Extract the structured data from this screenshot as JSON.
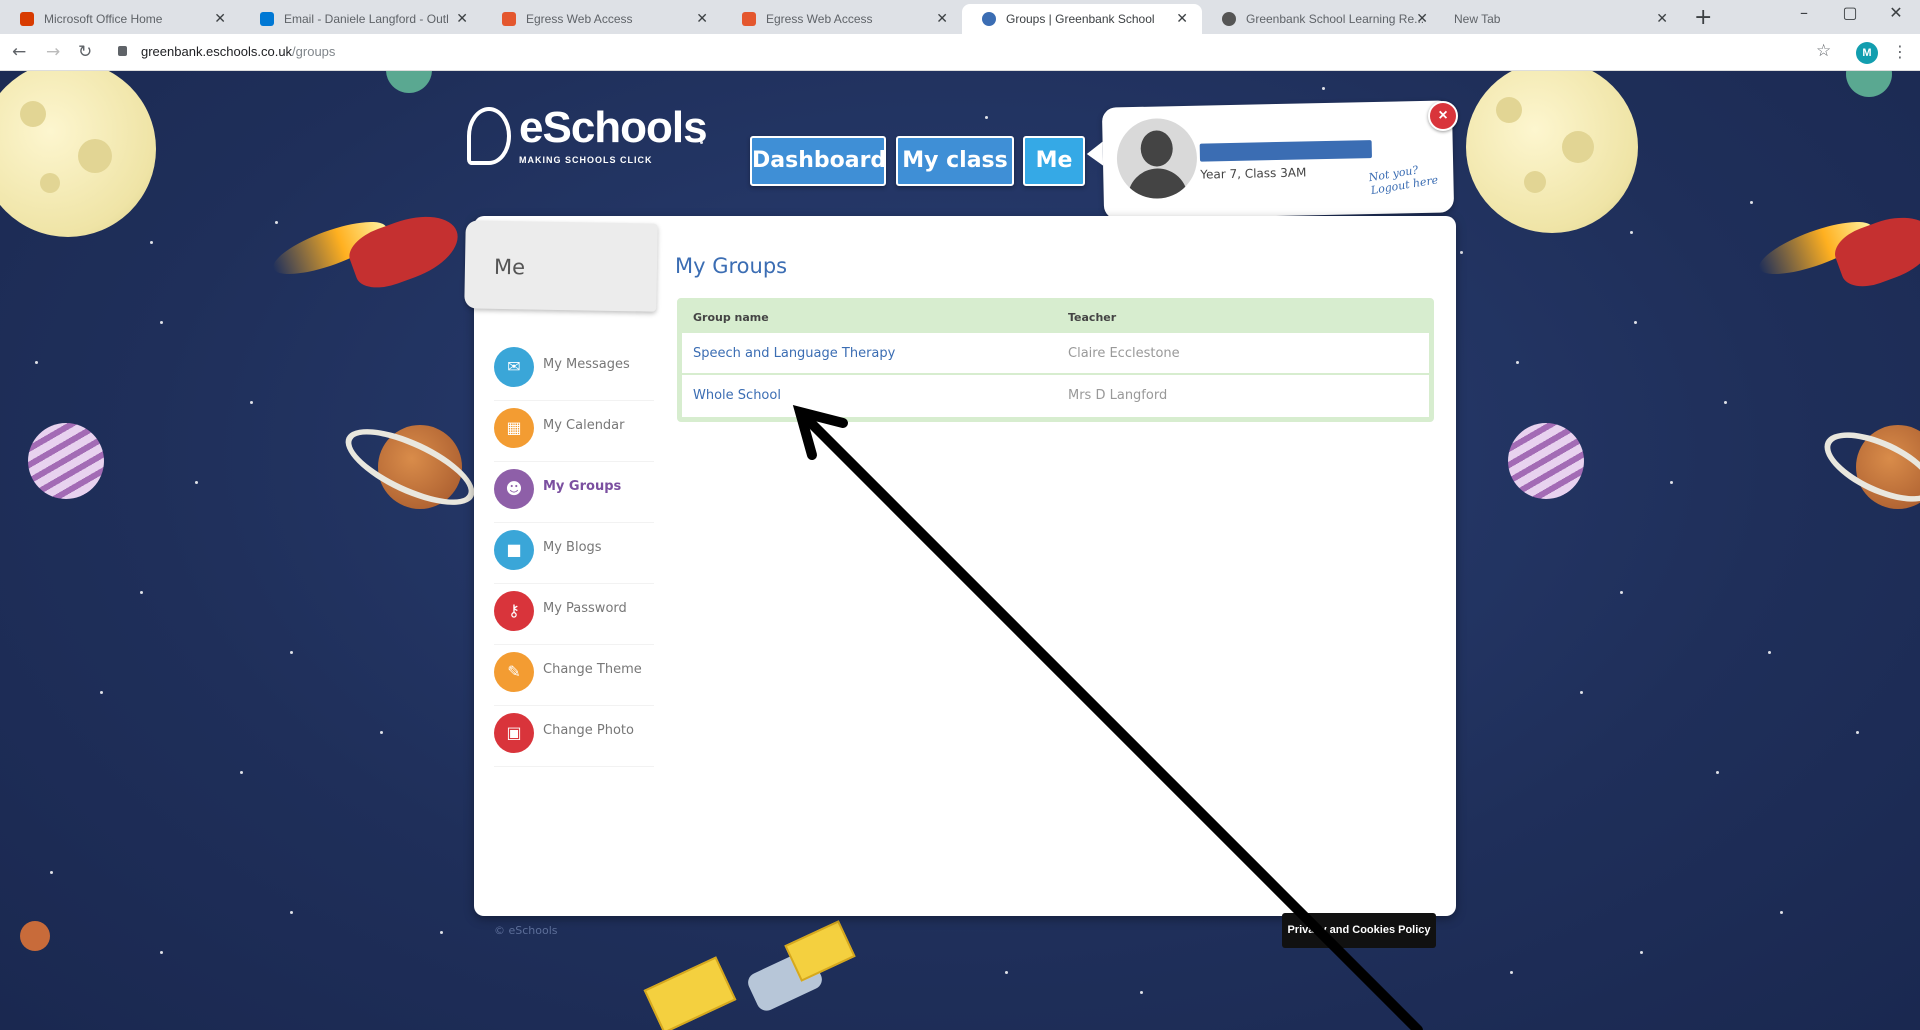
{
  "browser": {
    "tabs": [
      {
        "title": "Microsoft Office Home",
        "icon": "office-icon",
        "color": "#d83b01"
      },
      {
        "title": "Email - Daniele Langford - Outl",
        "icon": "outlook-icon",
        "color": "#0078d4"
      },
      {
        "title": "Egress Web Access",
        "icon": "egress-icon",
        "color": "#e4572e"
      },
      {
        "title": "Egress Web Access",
        "icon": "egress-icon",
        "color": "#e4572e"
      },
      {
        "title": "Groups | Greenbank School",
        "icon": "eschools-icon",
        "color": "#3b6db3"
      },
      {
        "title": "Greenbank School Learning Re...",
        "icon": "school-icon",
        "color": "#555555"
      },
      {
        "title": "New Tab",
        "icon": "",
        "color": ""
      }
    ],
    "url_host": "greenbank.eschools.co.uk",
    "url_path": "/groups",
    "profile_initial": "M",
    "controls": {
      "minimize": "–",
      "maximize": "▢",
      "close": "✕",
      "new_tab": "+"
    }
  },
  "site": {
    "logo_name": "eSchools",
    "logo_tagline": "MAKING SCHOOLS CLICK",
    "nav": [
      {
        "label": "Dashboard"
      },
      {
        "label": "My class"
      },
      {
        "label": "Me"
      }
    ],
    "profile": {
      "class_text": "Year 7, Class 3AM",
      "logout_note": "Not you? Logout here",
      "close_label": "×"
    }
  },
  "sidebar": {
    "section_title": "Me",
    "items": [
      {
        "label": "My Messages",
        "icon": "envelope-icon",
        "glyph": "✉",
        "color": "#3aa6d8"
      },
      {
        "label": "My Calendar",
        "icon": "calendar-icon",
        "glyph": "▦",
        "color": "#f39c32"
      },
      {
        "label": "My Groups",
        "icon": "groups-icon",
        "glyph": "☻",
        "color": "#8e5fa8",
        "active": true
      },
      {
        "label": "My Blogs",
        "icon": "blog-icon",
        "glyph": "■",
        "color": "#3aa6d8"
      },
      {
        "label": "My Password",
        "icon": "key-icon",
        "glyph": "⚷",
        "color": "#d9343b"
      },
      {
        "label": "Change Theme",
        "icon": "pencil-icon",
        "glyph": "✎",
        "color": "#f39c32"
      },
      {
        "label": "Change Photo",
        "icon": "photo-icon",
        "glyph": "▣",
        "color": "#d9343b"
      }
    ]
  },
  "groups": {
    "title": "My Groups",
    "columns": [
      "Group name",
      "Teacher"
    ],
    "rows": [
      {
        "name": "Speech and Language Therapy",
        "teacher": "Claire Ecclestone"
      },
      {
        "name": "Whole School",
        "teacher": "Mrs D Langford"
      }
    ]
  },
  "footer": {
    "copyright": "© eSchools",
    "privacy_label": "Privacy and Cookies Policy"
  }
}
